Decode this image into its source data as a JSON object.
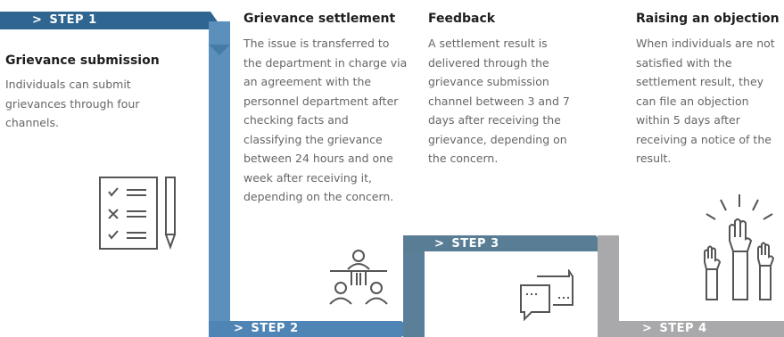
{
  "colors": {
    "step1": "#2f6591",
    "step2": "#4f85b4",
    "step3": "#5a7d96",
    "step4": "#a9a9ab",
    "title": "#1f1f1f",
    "text": "#666666"
  },
  "steps": [
    {
      "label": "STEP 1",
      "title": "Grievance submission",
      "description": "Individuals can submit grievances through four channels.",
      "icon": "checklist-pencil-icon"
    },
    {
      "label": "STEP 2",
      "title": "Grievance settlement",
      "description": "The issue is transferred to the department in charge via an agreement with the personnel department after checking facts and classifying the grievance between 24 hours and one week after receiving it, depending on the concern.",
      "icon": "meeting-icon"
    },
    {
      "label": "STEP 3",
      "title": "Feedback",
      "description": "A settlement result is delivered through the grievance submission channel between 3 and 7 days after receiving the grievance, depending on the concern.",
      "icon": "chat-bubbles-icon"
    },
    {
      "label": "STEP 4",
      "title": "Raising an objection",
      "description": "When individuals are not satisfied with the settlement result, they can file an objection within 5 days after receiving a notice of the result.",
      "icon": "raised-hands-icon"
    }
  ],
  "chevron": ">"
}
